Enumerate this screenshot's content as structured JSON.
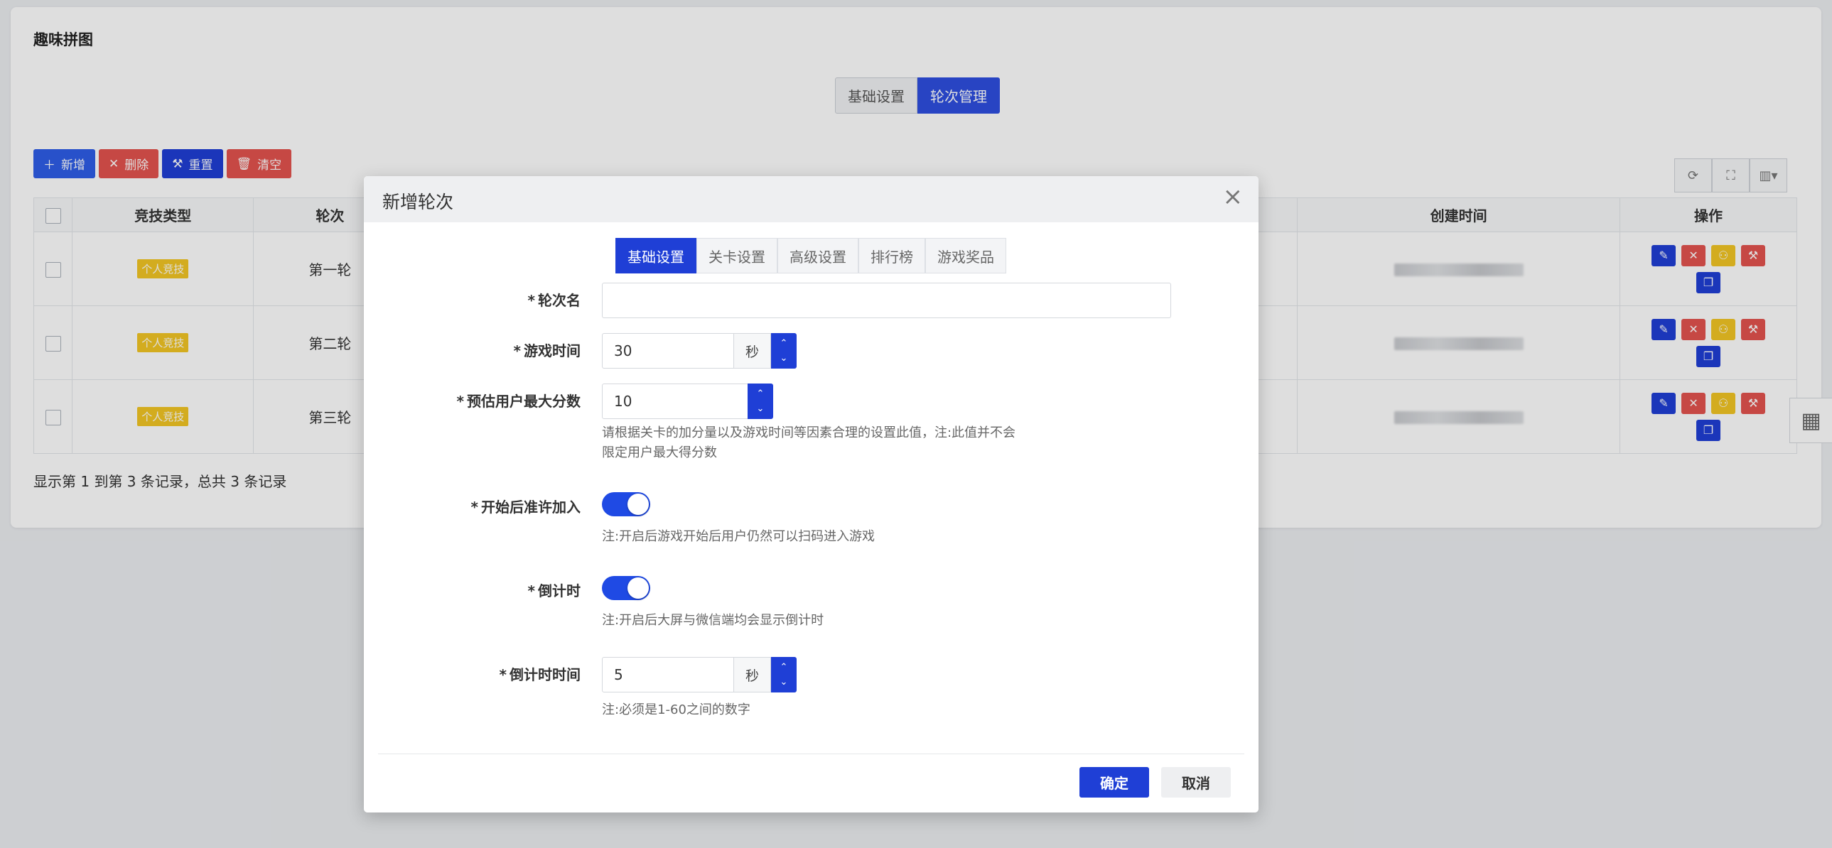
{
  "page": {
    "title": "趣味拼图",
    "tabs": [
      {
        "label": "基础设置",
        "active": false
      },
      {
        "label": "轮次管理",
        "active": true
      }
    ]
  },
  "toolbar": {
    "add": "新增",
    "delete": "删除",
    "reset": "重置",
    "clear": "清空"
  },
  "table": {
    "headers": {
      "type": "竞技类型",
      "round": "轮次",
      "created": "创建时间",
      "ops": "操作"
    },
    "rows": [
      {
        "type": "个人竞技",
        "round": "第一轮"
      },
      {
        "type": "个人竞技",
        "round": "第二轮"
      },
      {
        "type": "个人竞技",
        "round": "第三轮"
      }
    ],
    "footer": "显示第 1 到第 3 条记录，总共 3 条记录"
  },
  "modal": {
    "title": "新增轮次",
    "tabs": [
      "基础设置",
      "关卡设置",
      "高级设置",
      "排行榜",
      "游戏奖品"
    ],
    "active_tab": "基础设置",
    "fields": {
      "round_name": {
        "label": "轮次名",
        "value": ""
      },
      "game_time": {
        "label": "游戏时间",
        "value": "30",
        "unit": "秒"
      },
      "max_score": {
        "label": "预估用户最大分数",
        "value": "10",
        "hint": "请根据关卡的加分量以及游戏时间等因素合理的设置此值，注:此值并不会限定用户最大得分数"
      },
      "allow_join": {
        "label": "开始后准许加入",
        "enabled": true,
        "hint": "注:开启后游戏开始后用户仍然可以扫码进入游戏"
      },
      "countdown": {
        "label": "倒计时",
        "enabled": true,
        "hint": "注:开启后大屏与微信端均会显示倒计时"
      },
      "countdown_time": {
        "label": "倒计时时间",
        "value": "5",
        "unit": "秒",
        "hint": "注:必须是1-60之间的数字"
      }
    },
    "ok_label": "确定",
    "cancel_label": "取消"
  },
  "colors": {
    "primary": "#1f3fd6",
    "danger": "#e4534f",
    "warning": "#f3c624"
  }
}
